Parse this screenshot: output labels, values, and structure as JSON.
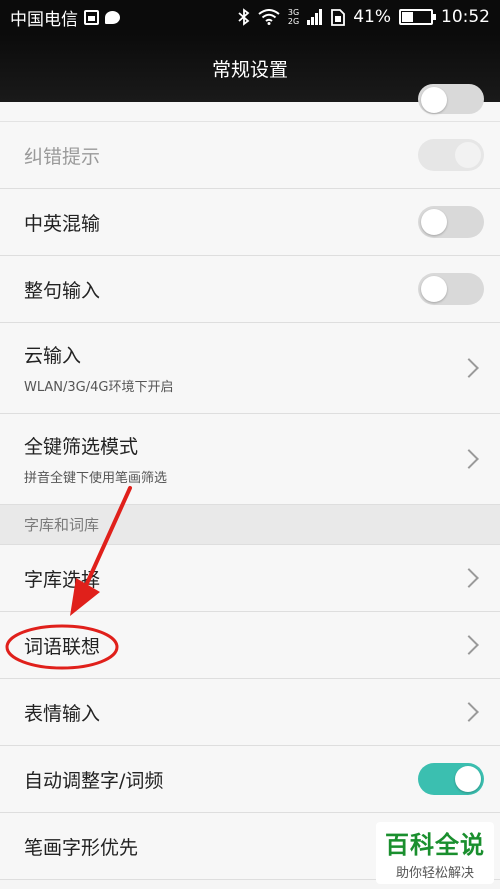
{
  "statusbar": {
    "carrier": "中国电信",
    "net_top": "3G",
    "net_bottom": "2G",
    "battery_percent": "41%",
    "battery_level": 0.41,
    "time": "10:52",
    "icons": [
      "sim-icon",
      "chat-icon",
      "bluetooth-icon",
      "wifi-icon",
      "signal-icon",
      "sim-card-icon",
      "battery-icon"
    ]
  },
  "header": {
    "title": "常规设置"
  },
  "settings": {
    "error_hint": {
      "label": "纠错提示",
      "state": "on-disabled"
    },
    "mixed_input": {
      "label": "中英混输",
      "state": "off"
    },
    "sentence_input": {
      "label": "整句输入",
      "state": "off"
    },
    "cloud_input": {
      "label": "云输入",
      "sub": "WLAN/3G/4G环境下开启"
    },
    "full_key_filter": {
      "label": "全键筛选模式",
      "sub": "拼音全键下使用笔画筛选"
    }
  },
  "section": {
    "title": "字库和词库"
  },
  "library": {
    "lexicon_select": {
      "label": "字库选择"
    },
    "word_association": {
      "label": "词语联想"
    },
    "emoji_input": {
      "label": "表情输入"
    },
    "auto_freq": {
      "label": "自动调整字/词频",
      "state": "on"
    },
    "stroke_priority": {
      "label": "笔画字形优先"
    }
  },
  "watermark": {
    "big": "百科全说",
    "small": "助你轻松解决"
  },
  "colors": {
    "accent": "#3bbfb0",
    "annotation": "#e0201b",
    "watermark": "#1a8f2e"
  }
}
